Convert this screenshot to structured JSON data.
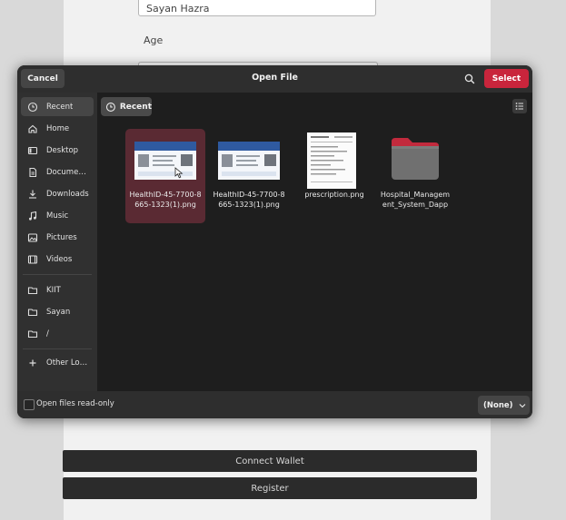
{
  "background": {
    "name_value": "Sayan Hazra",
    "age_label": "Age",
    "connect_wallet_label": "Connect Wallet",
    "register_label": "Register"
  },
  "dialog": {
    "title": "Open File",
    "cancel_label": "Cancel",
    "select_label": "Select",
    "accent_color": "#c9253c",
    "location_chip": "Recent",
    "sidebar": {
      "items": [
        {
          "label": "Recent",
          "icon": "clock-icon"
        },
        {
          "label": "Home",
          "icon": "home-icon"
        },
        {
          "label": "Desktop",
          "icon": "desktop-icon"
        },
        {
          "label": "Docume…",
          "icon": "document-icon"
        },
        {
          "label": "Downloads",
          "icon": "download-icon"
        },
        {
          "label": "Music",
          "icon": "music-icon"
        },
        {
          "label": "Pictures",
          "icon": "picture-icon"
        },
        {
          "label": "Videos",
          "icon": "video-icon"
        },
        {
          "label": "KIIT",
          "icon": "folder-icon"
        },
        {
          "label": "Sayan",
          "icon": "folder-icon"
        },
        {
          "label": "/",
          "icon": "folder-icon"
        },
        {
          "label": "Other Lo…",
          "icon": "plus-icon"
        }
      ]
    },
    "files": [
      {
        "name": "HealthID-45-7700-8665-1323(1).png",
        "type": "image",
        "selected": true
      },
      {
        "name": "HealthID-45-7700-8665-1323(1).png",
        "type": "image",
        "selected": false
      },
      {
        "name": "prescription.png",
        "type": "image",
        "selected": false
      },
      {
        "name": "Hospital_Management_System_Dapp",
        "type": "folder",
        "selected": false
      }
    ],
    "footer": {
      "readonly_label": "Open files read-only",
      "readonly_checked": false,
      "filter_value": "(None)"
    }
  }
}
